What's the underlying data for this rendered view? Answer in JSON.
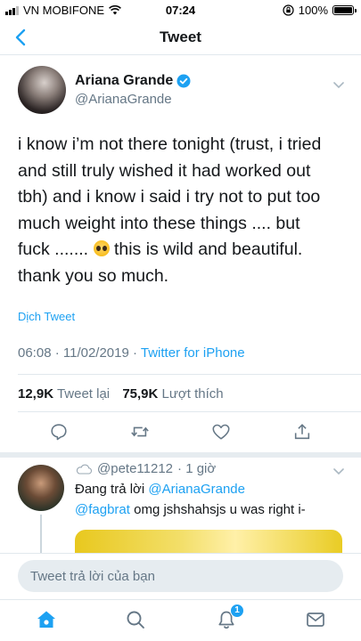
{
  "status_bar": {
    "carrier": "VN MOBIFONE",
    "time": "07:24",
    "battery": "100%"
  },
  "nav": {
    "title": "Tweet",
    "back_icon": "chevron-left-icon"
  },
  "tweet": {
    "author_name": "Ariana Grande",
    "author_handle": "@ArianaGrande",
    "text_lines": [
      "i know i’m not there tonight (trust, i tried",
      "and still truly wished it had worked out",
      "tbh) and i know i said i try not to put too",
      "much weight into these things .... but",
      "fuck .......",
      "this is wild and beautiful.",
      "thank you so much."
    ],
    "emoji": "pleading-face-emoji",
    "translate_label": "Dịch Tweet",
    "timestamp": "06:08 · 11/02/2019 · ",
    "source": "Twitter for iPhone",
    "retweet_count": "12,9K",
    "retweet_label": "Tweet lại",
    "like_count": "75,9K",
    "like_label": "Lượt thích"
  },
  "reply": {
    "handle": "@pete11212",
    "age": "· 1 giờ",
    "replying_prefix": "Đang trả lời ",
    "replying_to": "@ArianaGrande",
    "mention": "@fagbrat",
    "text": " omg jshshahsjs u was right i-"
  },
  "composer": {
    "placeholder": "Tweet trả lời của bạn"
  },
  "tabbar": {
    "notifications_badge": "1"
  },
  "colors": {
    "accent": "#1da1f2",
    "secondary_text": "#657786",
    "divider": "#e1e8ed"
  }
}
